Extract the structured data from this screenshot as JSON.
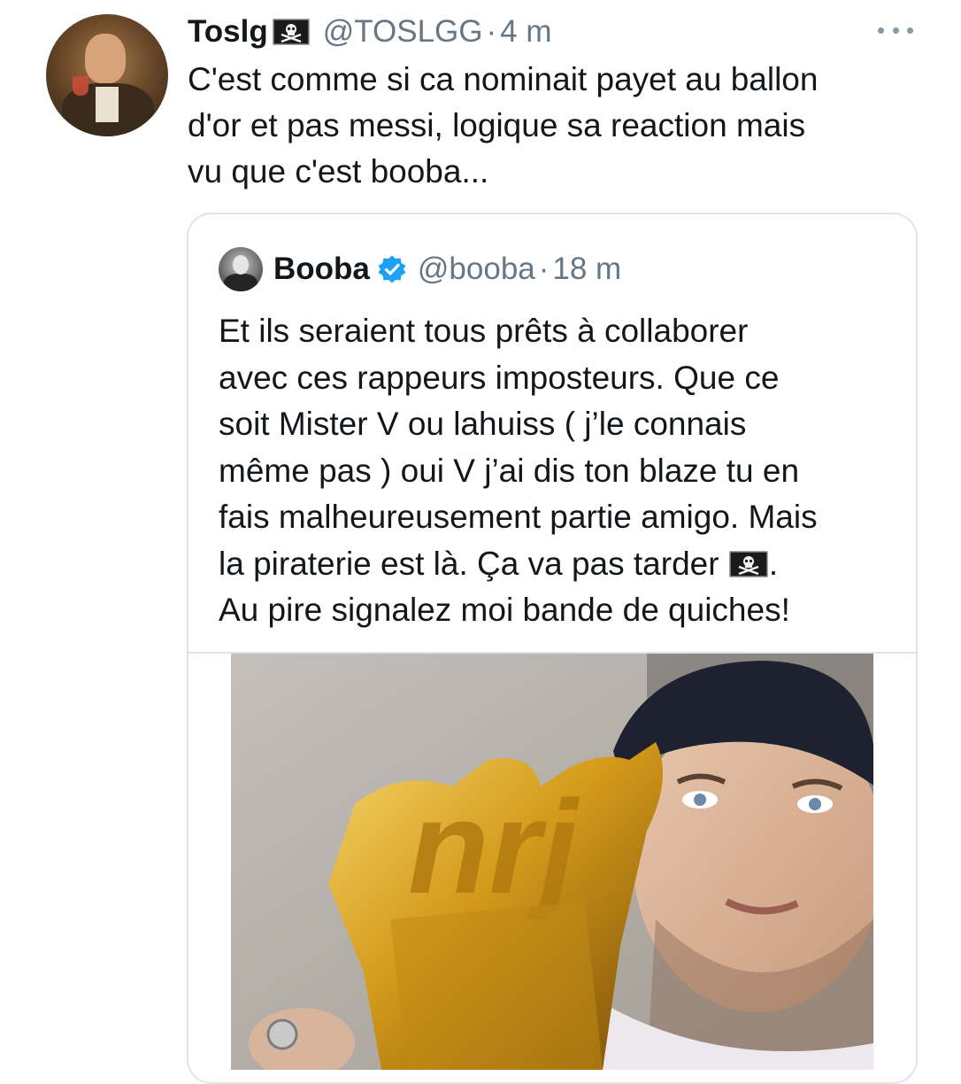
{
  "tweet": {
    "display_name": "Toslg",
    "handle": "@TOSLGG",
    "separator": "·",
    "time": "4 m",
    "text_lines": [
      "C'est comme si ca nominait payet au ballon",
      "d'or et pas messi, logique sa reaction mais",
      "vu que c'est booba..."
    ],
    "flag_icon": "pirate-flag-icon",
    "more_icon": "more-options-icon"
  },
  "quote": {
    "display_name": "Booba",
    "handle": "@booba",
    "separator": "·",
    "time": "18 m",
    "verified_icon": "verified-badge-icon",
    "verified_color": "#1da1f2",
    "text_lines": [
      "Et ils seraient tous prêts à collaborer",
      "avec ces rappeurs imposteurs. Que ce",
      "soit Mister V ou lahuiss ( j’le connais",
      "même pas ) oui V j’ai dis ton blaze tu en",
      "fais malheureusement partie amigo. Mais",
      "la piraterie est là. Ça va pas tarder ",
      "Au pire signalez moi bande de quiches!"
    ],
    "line6_suffix": ".",
    "image_caption": "",
    "trophy_text": "nrj"
  },
  "colors": {
    "text": "#14171a",
    "secondary": "#657786",
    "border": "#dfe4e8",
    "verified": "#1da1f2",
    "gold": "#d4a017"
  }
}
